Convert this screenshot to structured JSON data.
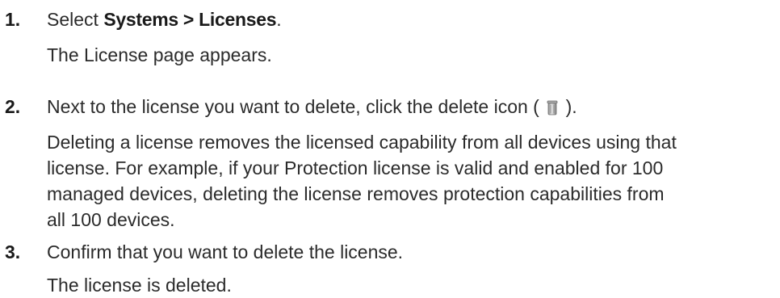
{
  "steps": [
    {
      "number": "1.",
      "prefix": "Select ",
      "bold": "Systems > Licenses",
      "suffix": ".",
      "result": "The License page appears."
    },
    {
      "number": "2.",
      "text_before_icon": "Next to the license you want to delete, click the delete icon ( ",
      "icon": "delete-icon",
      "text_after_icon": " ).",
      "detail_lines": [
        "Deleting a license removes the licensed capability from all devices using that",
        "license. For example, if your Protection license is valid and enabled for 100",
        "managed devices, deleting the license removes protection capabilities from",
        "all 100 devices."
      ]
    },
    {
      "number": "3.",
      "text": "Confirm that you want to delete the license.",
      "result": "The license is deleted."
    }
  ]
}
